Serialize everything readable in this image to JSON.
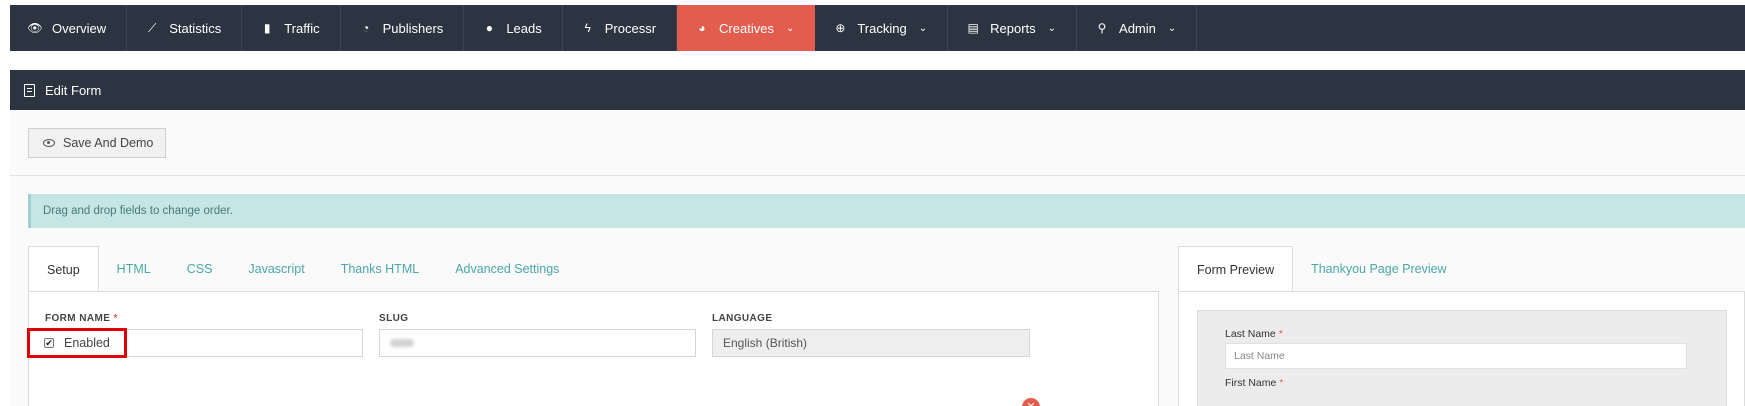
{
  "nav": {
    "items": [
      {
        "label": "Overview",
        "icon": "eye-icon",
        "glyph": "👁"
      },
      {
        "label": "Statistics",
        "icon": "chart-line-icon",
        "glyph": "⟋"
      },
      {
        "label": "Traffic",
        "icon": "traffic-light-icon",
        "glyph": "▮"
      },
      {
        "label": "Publishers",
        "icon": "magnet-icon",
        "glyph": "◔"
      },
      {
        "label": "Leads",
        "icon": "user-icon",
        "glyph": "●"
      },
      {
        "label": "Processr",
        "icon": "bolt-icon",
        "glyph": "ϟ"
      },
      {
        "label": "Creatives",
        "icon": "palette-icon",
        "glyph": "◕",
        "active": true,
        "dropdown": true
      },
      {
        "label": "Tracking",
        "icon": "crosshair-icon",
        "glyph": "⊕",
        "dropdown": true
      },
      {
        "label": "Reports",
        "icon": "report-icon",
        "glyph": "▤",
        "dropdown": true
      },
      {
        "label": "Admin",
        "icon": "wrench-icon",
        "glyph": "⚲",
        "dropdown": true
      }
    ],
    "chevron": "⌄",
    "active_color": "#e35d4f",
    "bg_color": "#2b3440"
  },
  "panel": {
    "title": "Edit Form",
    "icon": "form-icon"
  },
  "toolbar": {
    "save_demo_label": "Save And Demo"
  },
  "info": {
    "text": "Drag and drop fields to change order."
  },
  "tabs": [
    {
      "label": "Setup",
      "active": true
    },
    {
      "label": "HTML"
    },
    {
      "label": "CSS"
    },
    {
      "label": "Javascript"
    },
    {
      "label": "Thanks HTML"
    },
    {
      "label": "Advanced Settings"
    }
  ],
  "form": {
    "name_label": "FORM NAME",
    "required_mark": "*",
    "slug_label": "SLUG",
    "language_label": "LANGUAGE",
    "language_value": "English (British)",
    "enabled_label": "Enabled",
    "enabled_checked": true,
    "check_glyph": "✔",
    "close_glyph": "✕"
  },
  "preview_tabs": [
    {
      "label": "Form Preview",
      "active": true
    },
    {
      "label": "Thankyou Page Preview"
    }
  ],
  "preview": {
    "last_name_label": "Last Name",
    "last_name_placeholder": "Last Name",
    "first_name_label": "First Name",
    "required_mark": "*"
  }
}
